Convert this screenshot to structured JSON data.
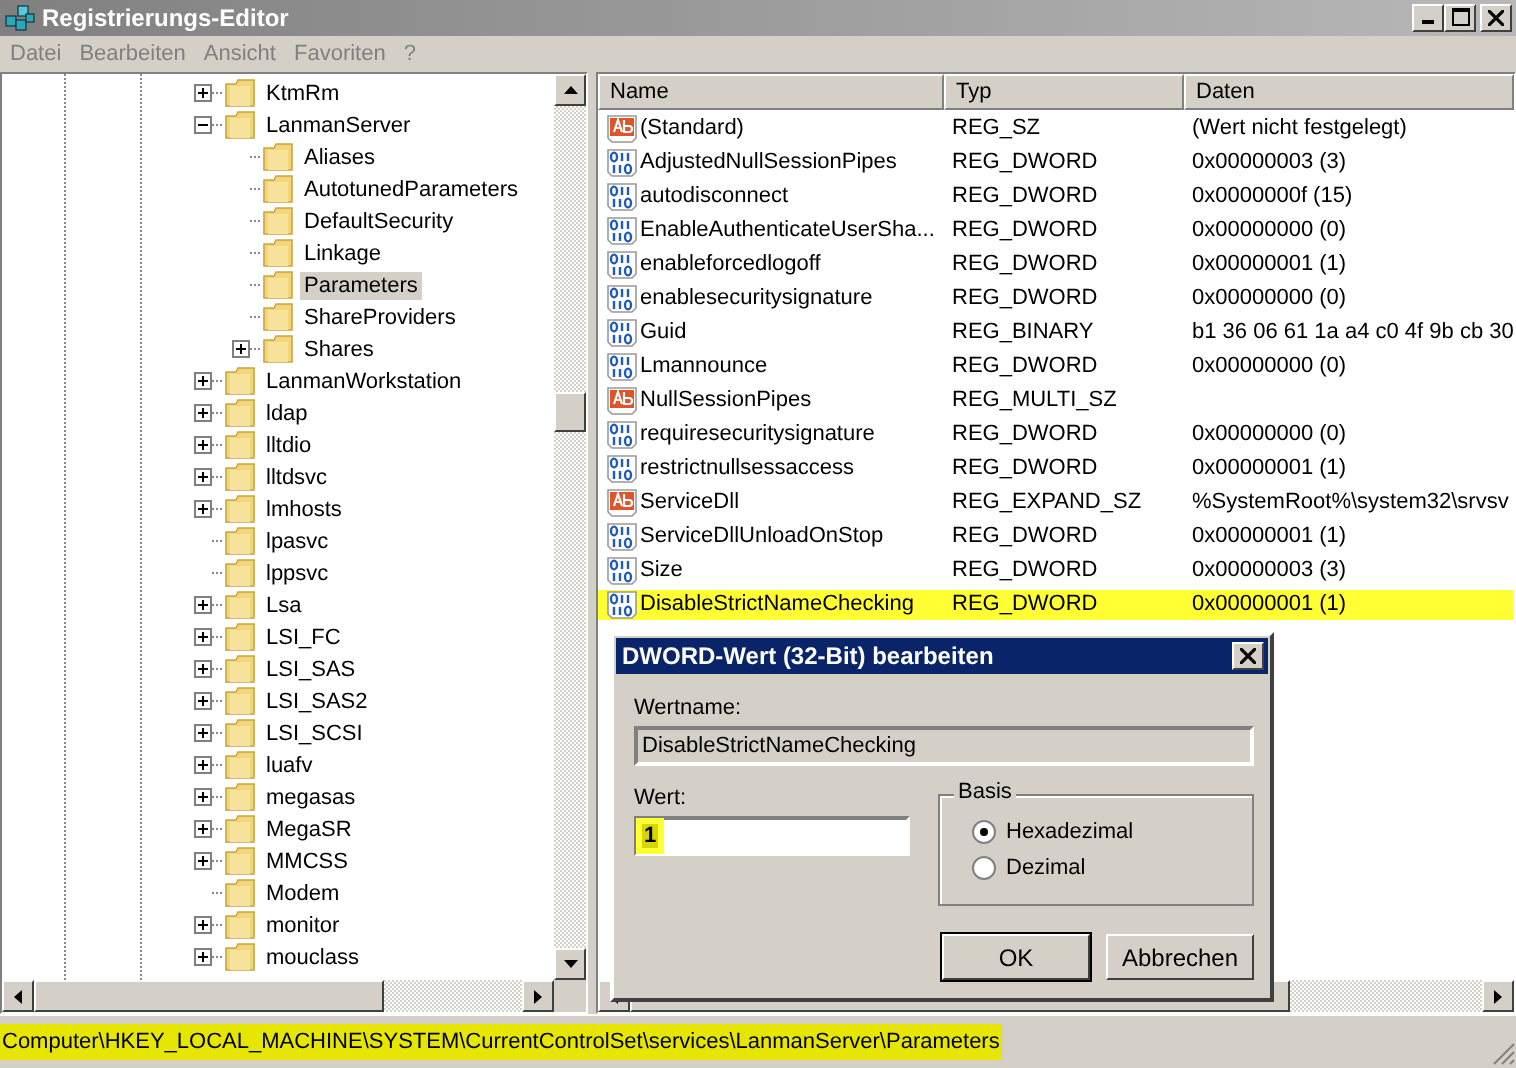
{
  "window": {
    "title": "Registrierungs-Editor"
  },
  "menu": [
    "Datei",
    "Bearbeiten",
    "Ansicht",
    "Favoriten",
    "?"
  ],
  "tree": [
    {
      "label": "KtmRm",
      "expandable": true,
      "expanded": false,
      "selected": false
    },
    {
      "label": "LanmanServer",
      "expandable": true,
      "expanded": true,
      "selected": false,
      "children": [
        {
          "label": "Aliases",
          "expandable": false,
          "selected": false
        },
        {
          "label": "AutotunedParameters",
          "expandable": false,
          "selected": false
        },
        {
          "label": "DefaultSecurity",
          "expandable": false,
          "selected": false
        },
        {
          "label": "Linkage",
          "expandable": false,
          "selected": false
        },
        {
          "label": "Parameters",
          "expandable": false,
          "selected": true
        },
        {
          "label": "ShareProviders",
          "expandable": false,
          "selected": false
        },
        {
          "label": "Shares",
          "expandable": true,
          "expanded": false,
          "selected": false
        }
      ]
    },
    {
      "label": "LanmanWorkstation",
      "expandable": true,
      "expanded": false,
      "selected": false
    },
    {
      "label": "ldap",
      "expandable": true,
      "expanded": false,
      "selected": false
    },
    {
      "label": "lltdio",
      "expandable": true,
      "expanded": false,
      "selected": false
    },
    {
      "label": "lltdsvc",
      "expandable": true,
      "expanded": false,
      "selected": false
    },
    {
      "label": "lmhosts",
      "expandable": true,
      "expanded": false,
      "selected": false
    },
    {
      "label": "lpasvc",
      "expandable": false,
      "selected": false
    },
    {
      "label": "lppsvc",
      "expandable": false,
      "selected": false
    },
    {
      "label": "Lsa",
      "expandable": true,
      "expanded": false,
      "selected": false
    },
    {
      "label": "LSI_FC",
      "expandable": true,
      "expanded": false,
      "selected": false
    },
    {
      "label": "LSI_SAS",
      "expandable": true,
      "expanded": false,
      "selected": false
    },
    {
      "label": "LSI_SAS2",
      "expandable": true,
      "expanded": false,
      "selected": false
    },
    {
      "label": "LSI_SCSI",
      "expandable": true,
      "expanded": false,
      "selected": false
    },
    {
      "label": "luafv",
      "expandable": true,
      "expanded": false,
      "selected": false
    },
    {
      "label": "megasas",
      "expandable": true,
      "expanded": false,
      "selected": false
    },
    {
      "label": "MegaSR",
      "expandable": true,
      "expanded": false,
      "selected": false
    },
    {
      "label": "MMCSS",
      "expandable": true,
      "expanded": false,
      "selected": false
    },
    {
      "label": "Modem",
      "expandable": false,
      "selected": false
    },
    {
      "label": "monitor",
      "expandable": true,
      "expanded": false,
      "selected": false
    },
    {
      "label": "mouclass",
      "expandable": true,
      "expanded": false,
      "selected": false
    }
  ],
  "list": {
    "columns": [
      "Name",
      "Typ",
      "Daten"
    ],
    "rows": [
      {
        "kind": "string",
        "name": "(Standard)",
        "type": "REG_SZ",
        "data": "(Wert nicht festgelegt)",
        "highlighted": false
      },
      {
        "kind": "binary",
        "name": "AdjustedNullSessionPipes",
        "type": "REG_DWORD",
        "data": "0x00000003 (3)",
        "highlighted": false
      },
      {
        "kind": "binary",
        "name": "autodisconnect",
        "type": "REG_DWORD",
        "data": "0x0000000f (15)",
        "highlighted": false
      },
      {
        "kind": "binary",
        "name": "EnableAuthenticateUserSha...",
        "type": "REG_DWORD",
        "data": "0x00000000 (0)",
        "highlighted": false
      },
      {
        "kind": "binary",
        "name": "enableforcedlogoff",
        "type": "REG_DWORD",
        "data": "0x00000001 (1)",
        "highlighted": false
      },
      {
        "kind": "binary",
        "name": "enablesecuritysignature",
        "type": "REG_DWORD",
        "data": "0x00000000 (0)",
        "highlighted": false
      },
      {
        "kind": "binary",
        "name": "Guid",
        "type": "REG_BINARY",
        "data": "b1 36 06 61 1a a4 c0 4f 9b cb 30",
        "highlighted": false
      },
      {
        "kind": "binary",
        "name": "Lmannounce",
        "type": "REG_DWORD",
        "data": "0x00000000 (0)",
        "highlighted": false
      },
      {
        "kind": "string",
        "name": "NullSessionPipes",
        "type": "REG_MULTI_SZ",
        "highlighted": false
      },
      {
        "kind": "binary",
        "name": "requiresecuritysignature",
        "type": "REG_DWORD",
        "data": "0x00000000 (0)",
        "highlighted": false
      },
      {
        "kind": "binary",
        "name": "restrictnullsessaccess",
        "type": "REG_DWORD",
        "data": "0x00000001 (1)",
        "highlighted": false
      },
      {
        "kind": "string",
        "name": "ServiceDll",
        "type": "REG_EXPAND_SZ",
        "data": "%SystemRoot%\\system32\\srvsv",
        "highlighted": false
      },
      {
        "kind": "binary",
        "name": "ServiceDllUnloadOnStop",
        "type": "REG_DWORD",
        "data": "0x00000001 (1)",
        "highlighted": false
      },
      {
        "kind": "binary",
        "name": "Size",
        "type": "REG_DWORD",
        "data": "0x00000003 (3)",
        "highlighted": false
      },
      {
        "kind": "binary",
        "name": "DisableStrictNameChecking",
        "type": "REG_DWORD",
        "data": "0x00000001 (1)",
        "highlighted": true
      }
    ]
  },
  "dialog": {
    "title": "DWORD-Wert (32-Bit) bearbeiten",
    "name_label": "Wertname:",
    "name_value": "DisableStrictNameChecking",
    "value_label": "Wert:",
    "value": "1",
    "value_highlighted": true,
    "base_label": "Basis",
    "bases": [
      {
        "label": "Hexadezimal",
        "selected": true
      },
      {
        "label": "Dezimal",
        "selected": false
      }
    ],
    "buttons": [
      "OK",
      "Abbrechen"
    ]
  },
  "status_bar": {
    "text": "Computer\\HKEY_LOCAL_MACHINE\\SYSTEM\\CurrentControlSet\\services\\LanmanServer\\Parameters",
    "highlighted": true
  }
}
